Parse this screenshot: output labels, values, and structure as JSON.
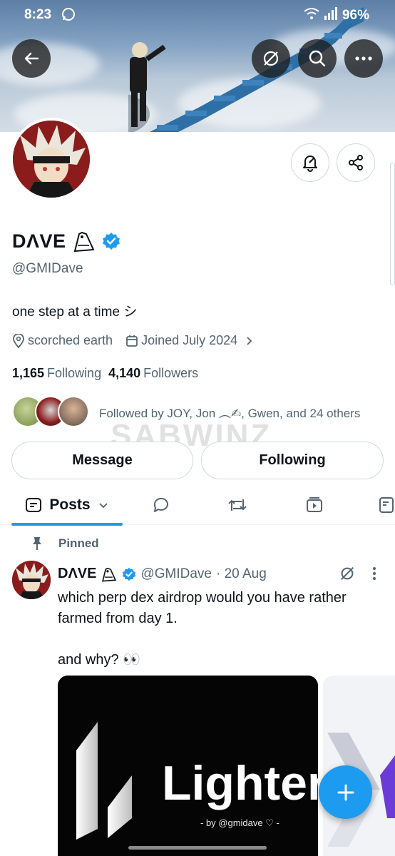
{
  "status_bar": {
    "time": "8:23",
    "battery": "96%"
  },
  "profile": {
    "display_name": "DΛVE",
    "handle": "@GMIDave",
    "bio": "one step at a time シ",
    "location": "scorched earth",
    "joined": "Joined July 2024",
    "following_count": "1,165",
    "following_label": "Following",
    "followers_count": "4,140",
    "followers_label": "Followers",
    "followed_by": "Followed by JOY, Jon ︵✍, Gwen, and 24 others"
  },
  "watermark": "SABWINZ",
  "actions": {
    "message": "Message",
    "following": "Following"
  },
  "tabs": {
    "posts": "Posts"
  },
  "pinned_post": {
    "pinned_label": "Pinned",
    "name": "DΛVE",
    "handle": "@GMIDave",
    "date": "· 20 Aug",
    "text": "which perp dex airdrop would you have rather farmed from day 1.\n\nand why? 👀",
    "media_title": "Lighter",
    "media_caption": "- by @gmidave ♡ -"
  },
  "colors": {
    "accent": "#1d9bf0",
    "text": "#0f1419",
    "muted": "#536471"
  }
}
